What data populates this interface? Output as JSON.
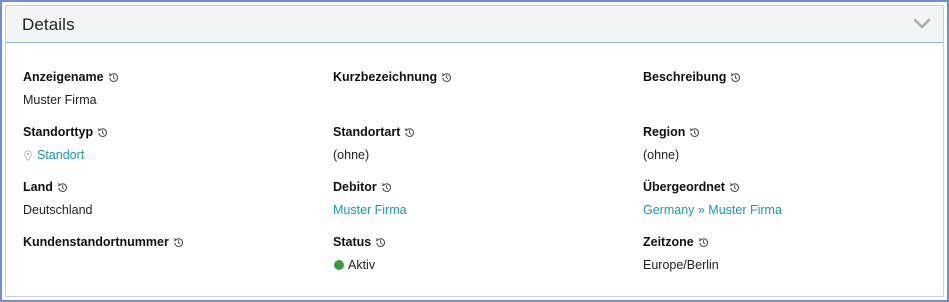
{
  "header": {
    "title": "Details"
  },
  "fields": [
    {
      "label": "Anzeigename",
      "value": "Muster Firma"
    },
    {
      "label": "Kurzbezeichnung",
      "value": ""
    },
    {
      "label": "Beschreibung",
      "value": ""
    },
    {
      "label": "Standorttyp",
      "value": "Standort",
      "icon": "map-pin-icon"
    },
    {
      "label": "Standortart",
      "value": "(ohne)"
    },
    {
      "label": "Region",
      "value": "(ohne)"
    },
    {
      "label": "Land",
      "value": "Deutschland"
    },
    {
      "label": "Debitor",
      "value": "Muster Firma"
    },
    {
      "label": "Übergeordnet",
      "value": "Germany » Muster Firma"
    },
    {
      "label": "Kundenstandortnummer",
      "value": ""
    },
    {
      "label": "Status",
      "value": "Aktiv",
      "icon": "status-dot-icon"
    },
    {
      "label": "Zeitzone",
      "value": "Europe/Berlin"
    }
  ],
  "colors": {
    "link": "#199aad",
    "status_active": "#2e9e3e",
    "accent_border": "#6e8fd1"
  },
  "icons": {
    "history": "history-icon",
    "collapse": "chevron-down-icon"
  }
}
